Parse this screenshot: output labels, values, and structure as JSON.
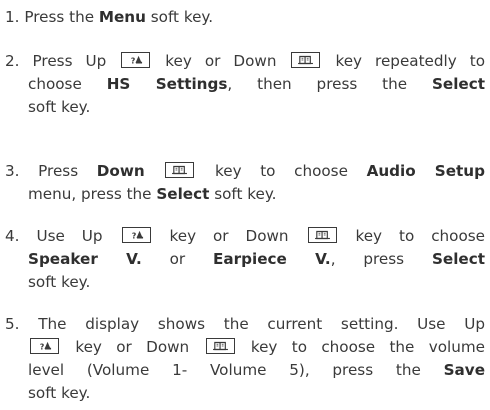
{
  "steps": [
    {
      "number": "1.",
      "lines": [
        [
          {
            "t": "Press the "
          },
          {
            "b": "Menu"
          },
          {
            "t": " soft key."
          }
        ]
      ]
    },
    {
      "number": "2.",
      "lines": [
        [
          {
            "t": "Press Up "
          },
          {
            "key": "up-key-icon"
          },
          {
            "t": " key or Down "
          },
          {
            "key": "down-key-icon"
          },
          {
            "t": " key repeatedly to"
          }
        ],
        [
          {
            "t": "choose "
          },
          {
            "b": "HS Settings"
          },
          {
            "t": ", then press the "
          },
          {
            "b": "Select"
          }
        ],
        [
          {
            "t": "soft key."
          }
        ]
      ]
    },
    {
      "number": "3.",
      "lines": [
        [
          {
            "t": "Press "
          },
          {
            "b": "Down"
          },
          {
            "t": " "
          },
          {
            "key": "down-key-icon"
          },
          {
            "t": " key to choose "
          },
          {
            "b": "Audio Setup"
          }
        ],
        [
          {
            "t": "menu, press the "
          },
          {
            "b": "Select"
          },
          {
            "t": " soft key."
          }
        ]
      ]
    },
    {
      "number": "4.",
      "lines": [
        [
          {
            "t": "Use Up "
          },
          {
            "key": "up-key-icon"
          },
          {
            "t": " key or Down "
          },
          {
            "key": "down-key-icon"
          },
          {
            "t": " key to choose"
          }
        ],
        [
          {
            "b": "Speaker V."
          },
          {
            "t": " or "
          },
          {
            "b": "Earpiece V."
          },
          {
            "t": ", press "
          },
          {
            "b": "Select"
          }
        ],
        [
          {
            "t": "soft key."
          }
        ]
      ]
    },
    {
      "number": "5.",
      "lines": [
        [
          {
            "t": "The display shows the current setting. Use Up"
          }
        ],
        [
          {
            "key": "up-key-icon"
          },
          {
            "t": " key or Down "
          },
          {
            "key": "down-key-icon"
          },
          {
            "t": " key to choose the volume"
          }
        ],
        [
          {
            "t": "level (Volume 1- Volume 5), press the "
          },
          {
            "b": "Save"
          }
        ],
        [
          {
            "t": "soft key."
          }
        ]
      ]
    }
  ]
}
